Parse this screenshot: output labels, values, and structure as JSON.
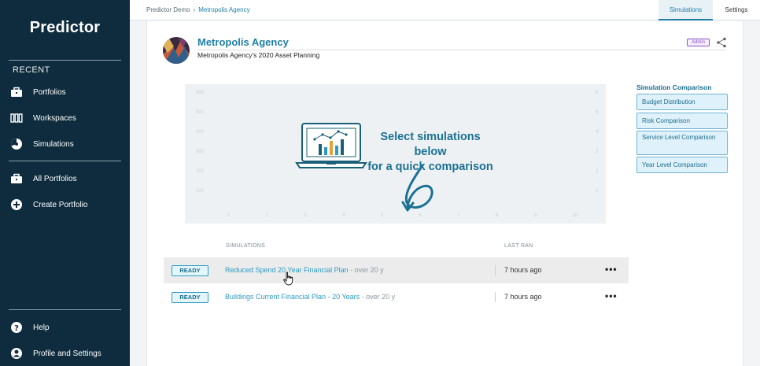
{
  "sidebar": {
    "brand": "Predictor",
    "recent_heading": "RECENT",
    "items": [
      {
        "label": "Portfolios",
        "icon": "briefcase-icon"
      },
      {
        "label": "Workspaces",
        "icon": "workspaces-icon"
      },
      {
        "label": "Simulations",
        "icon": "simulations-icon"
      },
      {
        "label": "All Portfolios",
        "icon": "briefcase-icon"
      },
      {
        "label": "Create Portfolio",
        "icon": "plus-circle-icon"
      }
    ],
    "bottom": [
      {
        "label": "Help",
        "icon": "help-icon"
      },
      {
        "label": "Profile and Settings",
        "icon": "user-icon"
      }
    ]
  },
  "breadcrumb": {
    "root": "Predictor Demo",
    "current": "Metropolis Agency"
  },
  "tabs": [
    {
      "label": "Simulations",
      "active": true
    },
    {
      "label": "Settings",
      "active": false
    }
  ],
  "org": {
    "title": "Metropolis Agency",
    "subtitle": "Metropolis Agency's 2020 Asset Planning",
    "badge": "Admin"
  },
  "chart_placeholder": {
    "message_line1": "Select simulations below",
    "message_line2": "for a quick comparison",
    "y_left": [
      "600",
      "500",
      "400",
      "300",
      "200",
      "100"
    ],
    "y_right": [
      "6",
      "5",
      "4",
      "3",
      "2",
      "1"
    ],
    "x": [
      "1",
      "2",
      "3",
      "4",
      "5",
      "6",
      "7",
      "8",
      "9",
      "10"
    ]
  },
  "comparison": {
    "title": "Simulation Comparison",
    "buttons": [
      "Budget Distribution",
      "Risk Comparison",
      "Service Level Comparison",
      "Year Level Comparison"
    ]
  },
  "table": {
    "headers": {
      "simulations": "SIMULATIONS",
      "last_ran": "LAST RAN"
    },
    "rows": [
      {
        "status": "READY",
        "name": "Reduced Spend 20 Year Financial Plan",
        "duration": " - over 20 y",
        "last_ran": "7 hours ago",
        "more": "•••"
      },
      {
        "status": "READY",
        "name": "Buildings Current Financial Plan - 20 Years",
        "duration": " - over 20 y",
        "last_ran": "7 hours ago",
        "more": "•••"
      }
    ]
  },
  "colors": {
    "sidebar": "#0e2c3e",
    "accent": "#1f7fa8",
    "badge": "#8a4fc0"
  }
}
